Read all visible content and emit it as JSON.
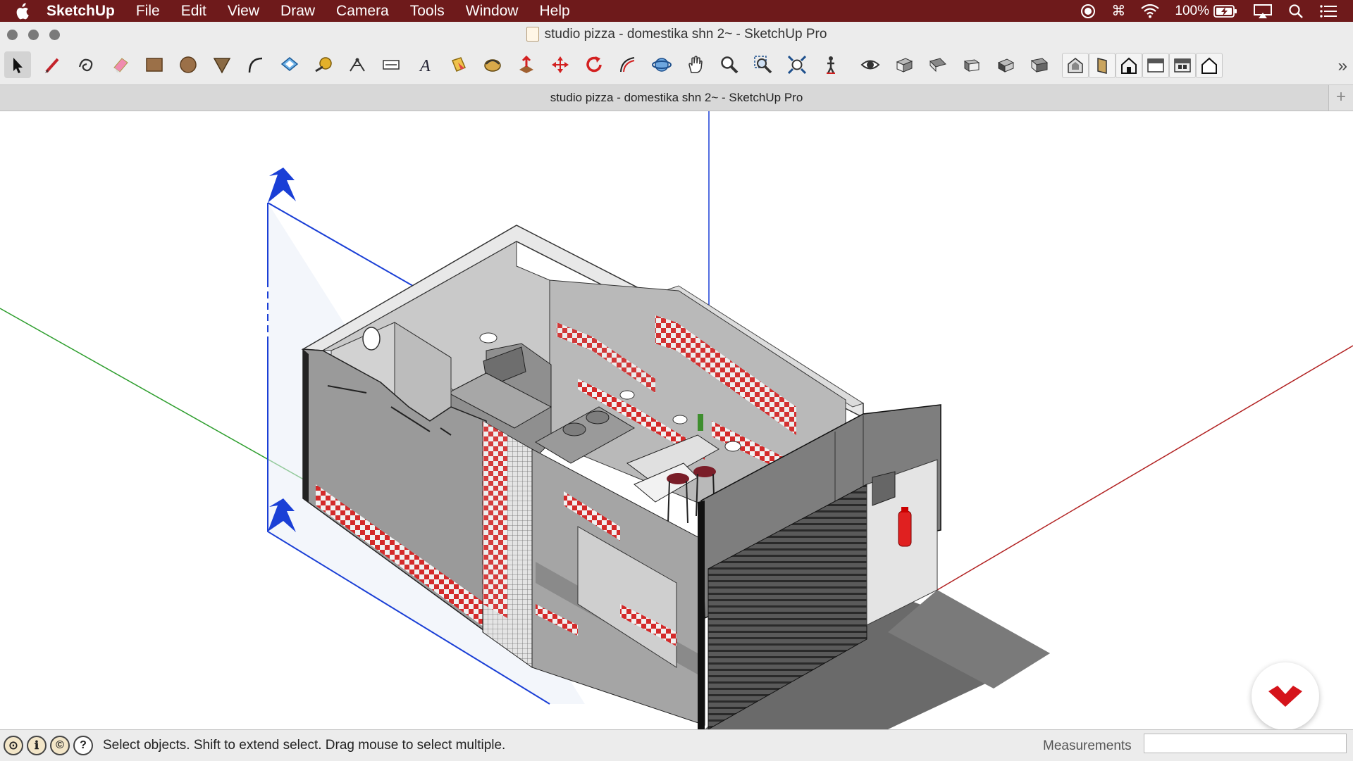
{
  "menubar": {
    "app": "SketchUp",
    "items": [
      "File",
      "Edit",
      "View",
      "Draw",
      "Camera",
      "Tools",
      "Window",
      "Help"
    ],
    "battery": "100%",
    "status_icons": [
      "record-icon",
      "command-icon",
      "wifi-icon",
      "battery-icon",
      "airplay-icon",
      "spotlight-icon",
      "control-center-icon"
    ]
  },
  "window": {
    "title": "studio pizza - domestika shn 2~ - SketchUp Pro",
    "tab_title": "studio pizza - domestika shn 2~ - SketchUp Pro"
  },
  "toolbar": {
    "tools": [
      "select",
      "line",
      "freehand",
      "eraser",
      "rectangle",
      "circle",
      "push-pull-triangle",
      "arc",
      "paint-bucket",
      "tape-measure",
      "dimension",
      "section-text",
      "text",
      "paint",
      "follow-me",
      "push-pull",
      "move",
      "rotate",
      "offset",
      "orbit",
      "pan",
      "zoom",
      "zoom-window",
      "zoom-extents",
      "position-camera",
      "look-around",
      "iso",
      "top",
      "front",
      "right",
      "back",
      "left-box",
      "standard-views-1",
      "standard-views-2",
      "standard-views-3",
      "standard-views-4",
      "standard-views-5",
      "standard-views-6"
    ],
    "overflow": "»"
  },
  "statusbar": {
    "hint": "Select objects. Shift to extend select. Drag mouse to select multiple.",
    "measurements_label": "Measurements",
    "measurements_value": "",
    "help": "?"
  },
  "colors": {
    "menubar_bg": "#6e1a1b",
    "section_plane": "#1a3fd6",
    "axis_red": "#b22222",
    "axis_green": "#2e9e2e",
    "tile_red": "#d42a2a",
    "brand_red": "#d5141b"
  }
}
